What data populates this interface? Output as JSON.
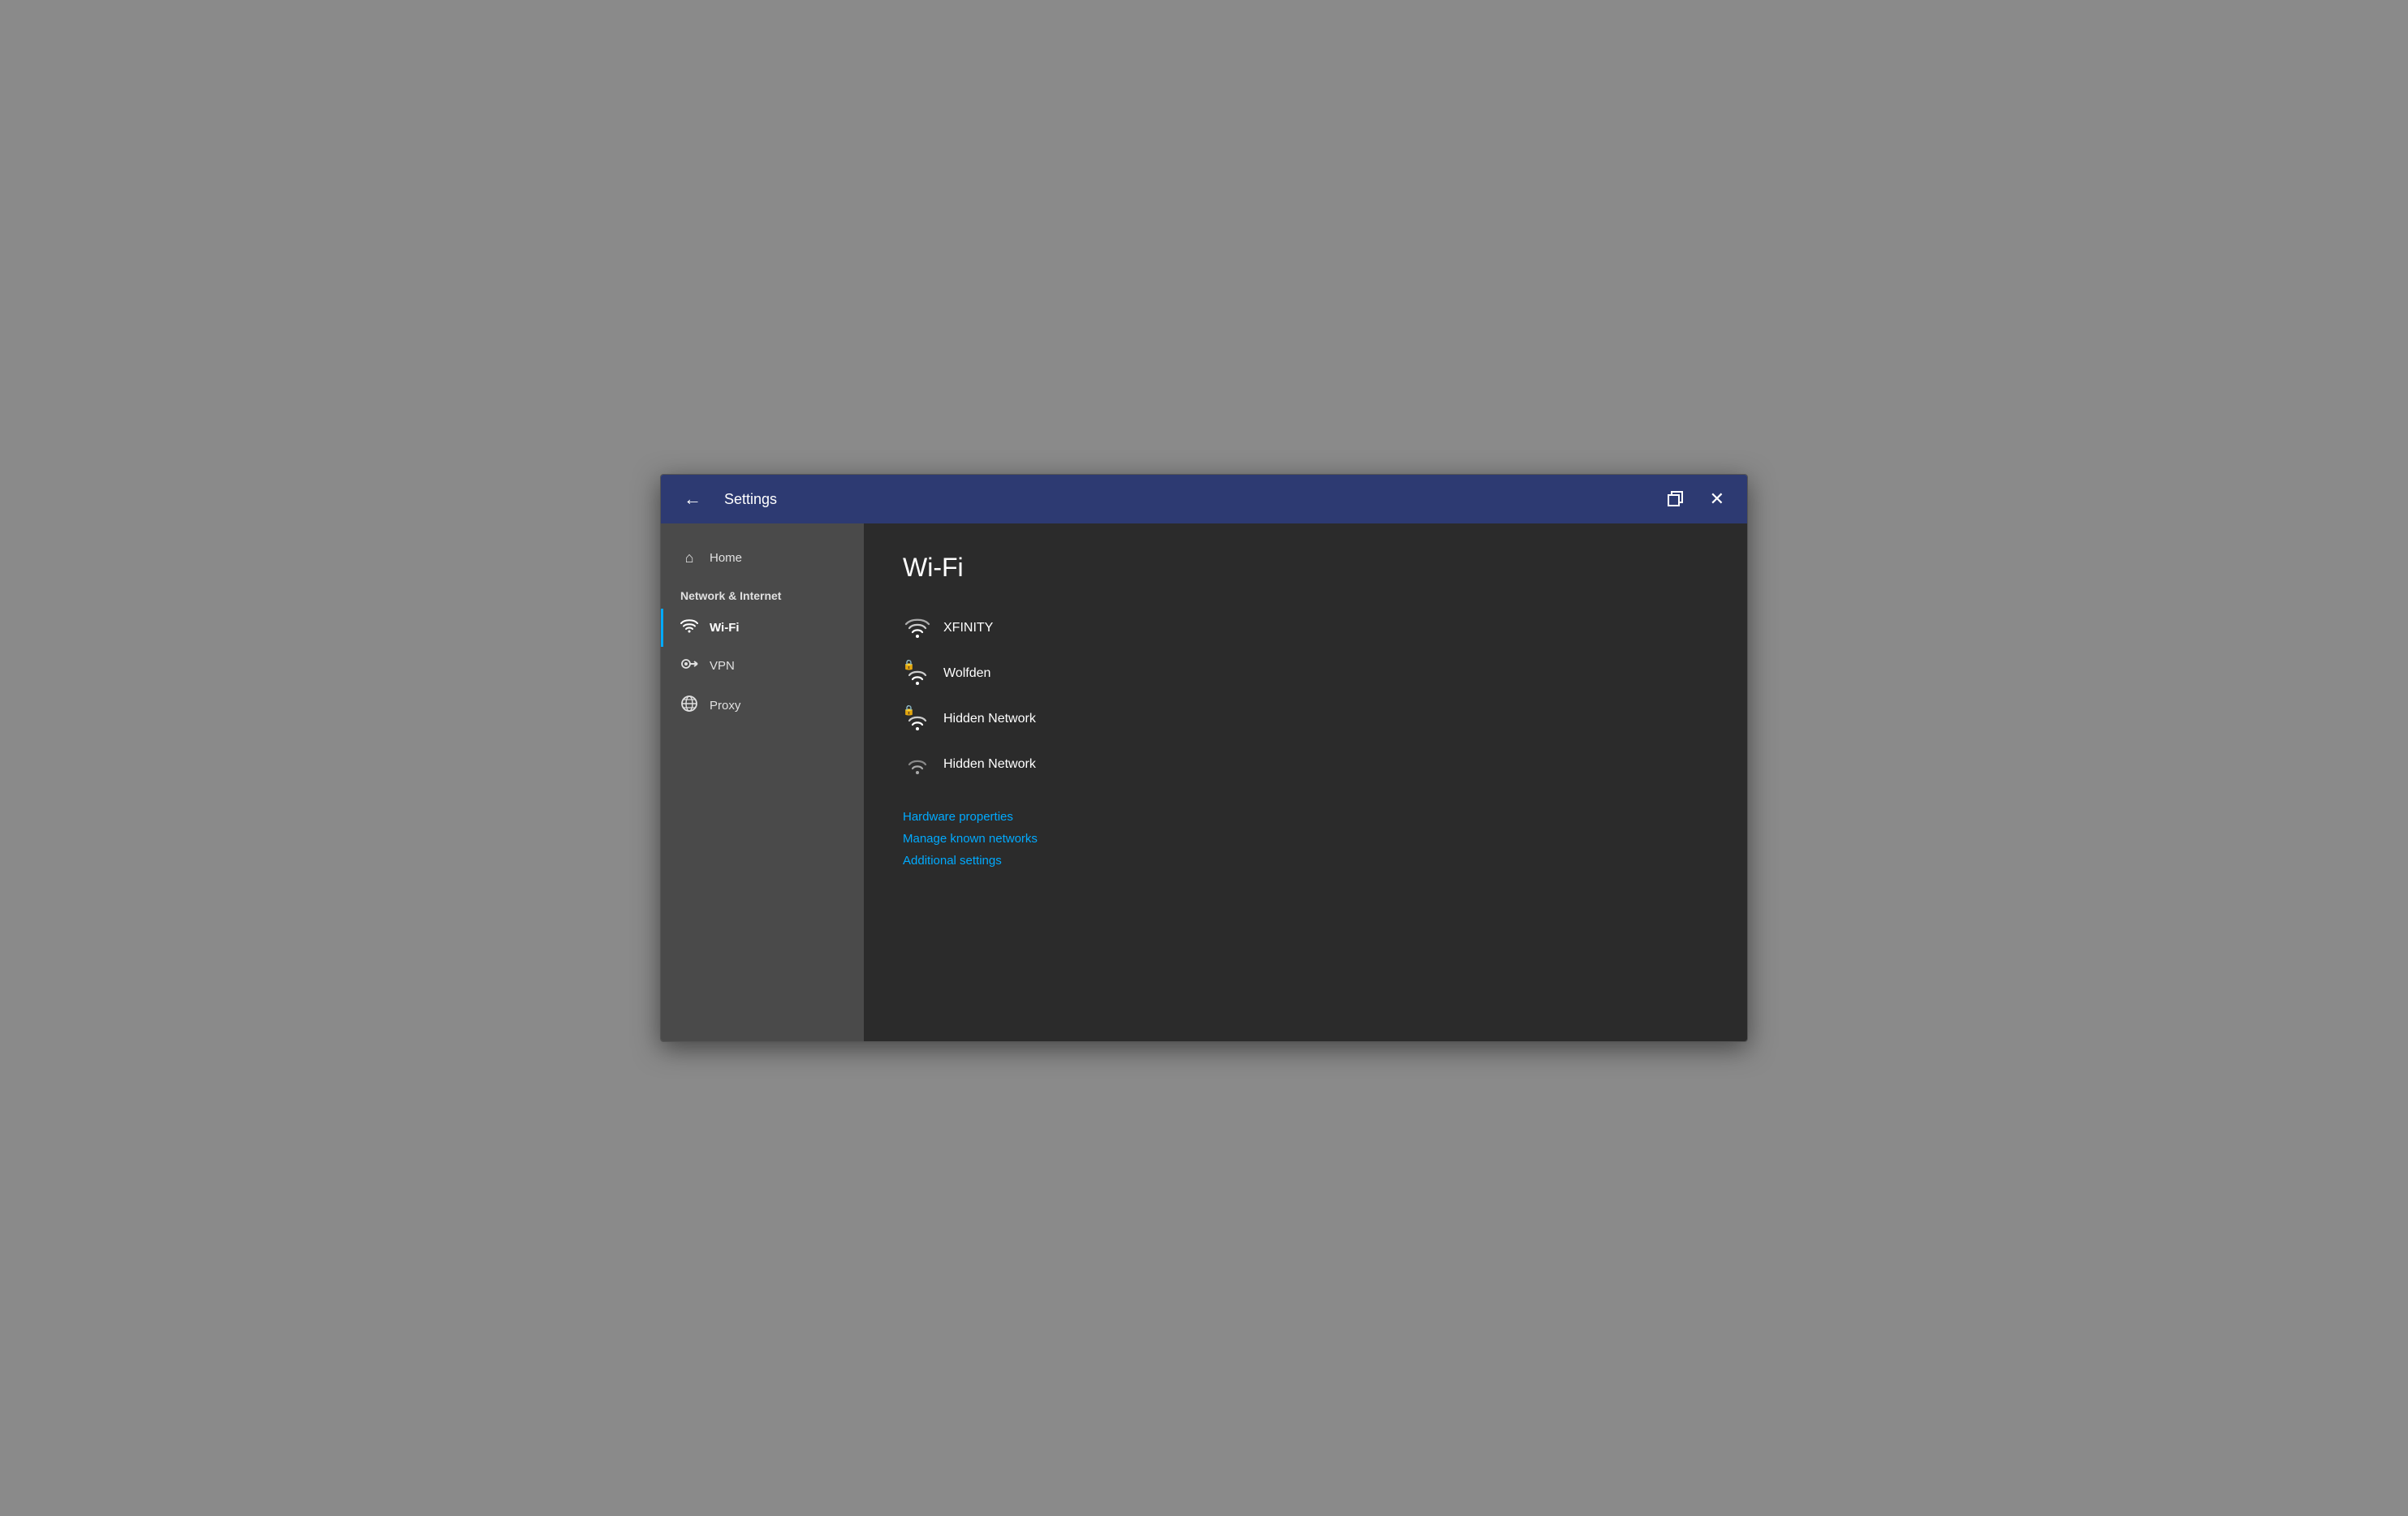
{
  "titlebar": {
    "back_label": "←",
    "title": "Settings",
    "restore_title": "Restore",
    "close_title": "Close"
  },
  "sidebar": {
    "home_label": "Home",
    "section_label": "Network & Internet",
    "items": [
      {
        "id": "wifi",
        "label": "Wi-Fi",
        "icon": "wifi",
        "active": true
      },
      {
        "id": "vpn",
        "label": "VPN",
        "icon": "vpn",
        "active": false
      },
      {
        "id": "proxy",
        "label": "Proxy",
        "icon": "proxy",
        "active": false
      }
    ]
  },
  "main": {
    "page_title": "Wi-Fi",
    "networks": [
      {
        "name": "XFINITY",
        "secured": false
      },
      {
        "name": "Wolfden",
        "secured": true
      },
      {
        "name": "Hidden Network",
        "secured": true
      },
      {
        "name": "Hidden Network",
        "secured": false
      }
    ],
    "links": [
      {
        "label": "Hardware properties"
      },
      {
        "label": "Manage known networks"
      },
      {
        "label": "Additional settings"
      }
    ]
  },
  "colors": {
    "accent": "#00aaff",
    "titlebar_bg": "#2d3a72",
    "sidebar_bg": "#4a4a4a",
    "main_bg": "#2b2b2b",
    "active_indicator": "#00aaff"
  }
}
